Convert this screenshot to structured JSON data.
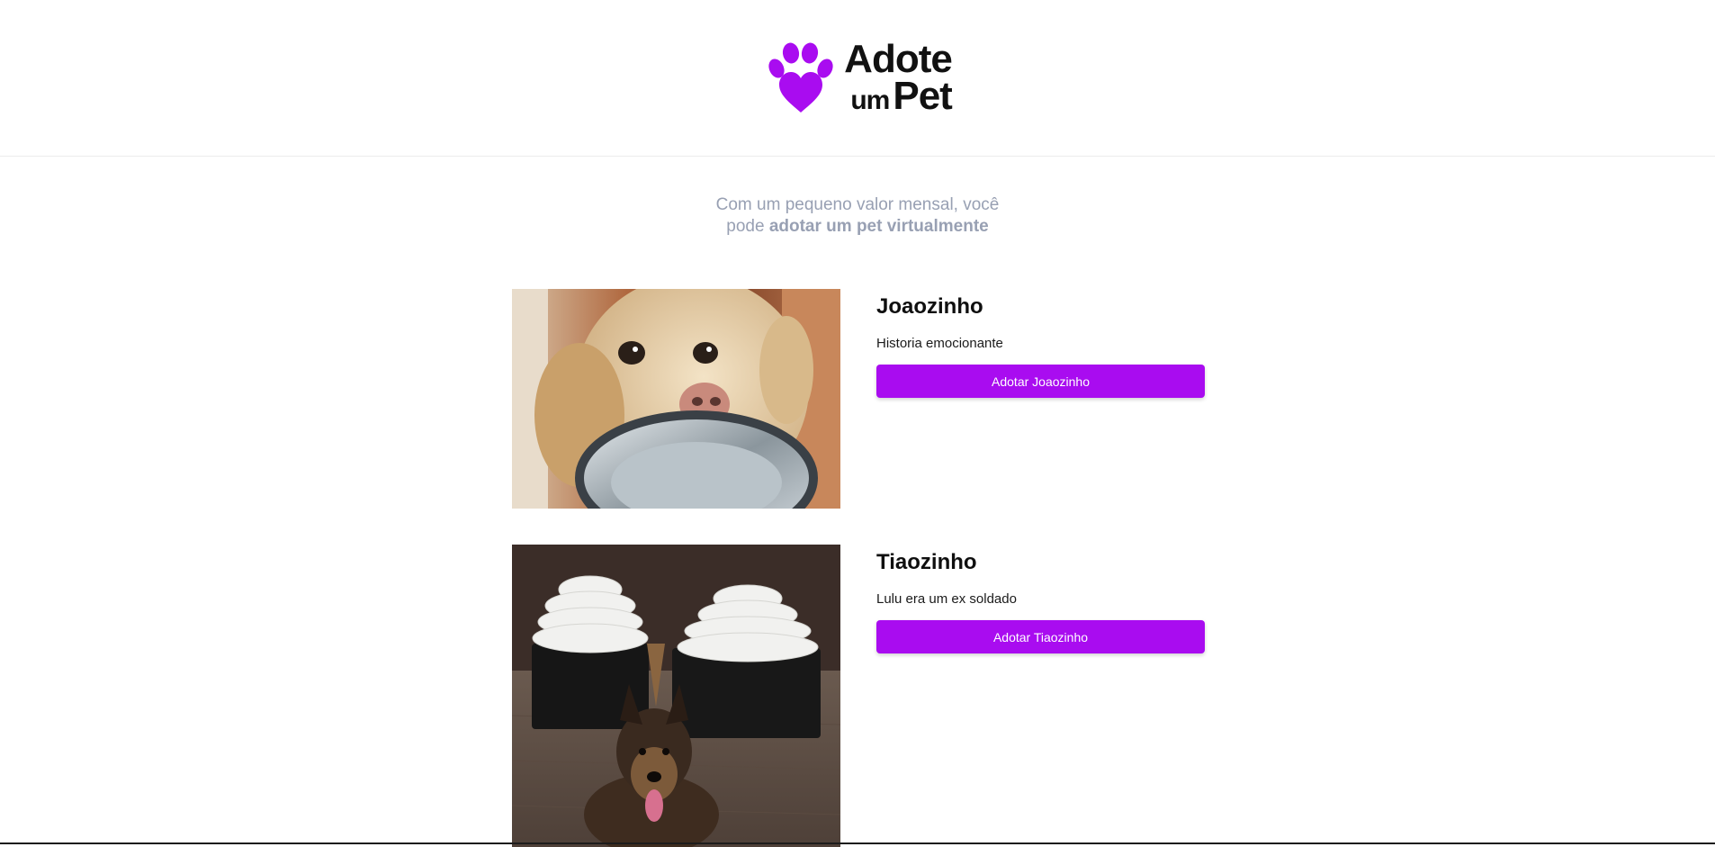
{
  "brand": {
    "line1": "Adote",
    "line2_small": "um",
    "line2_large": "Pet",
    "accent": "#a90cf0"
  },
  "intro": {
    "text_part1": "Com um pequeno valor mensal, você",
    "text_part2": "pode ",
    "text_bold": "adotar um pet virtualmente"
  },
  "pets": [
    {
      "name": "Joaozinho",
      "story": "Historia emocionante",
      "button_label": "Adotar Joaozinho",
      "image": "labrador-holding-bowl-photo"
    },
    {
      "name": "Tiaozinho",
      "story": "Lulu era um ex soldado",
      "button_label": "Adotar Tiaozinho",
      "image": "malinois-with-seized-bags-photo"
    }
  ]
}
